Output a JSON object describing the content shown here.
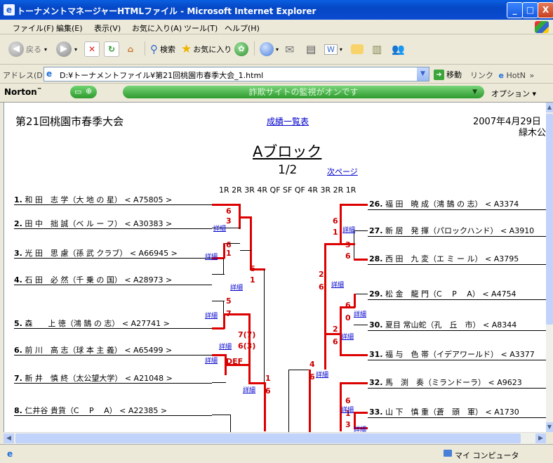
{
  "window": {
    "title": "トーナメントマネージャーHTMLファイル - Microsoft Internet Explorer",
    "controls": [
      "_",
      "□",
      "X"
    ]
  },
  "menu": [
    "ファイル(F)",
    "編集(E)",
    "表示(V)",
    "お気に入り(A)",
    "ツール(T)",
    "ヘルプ(H)"
  ],
  "toolbar": {
    "back": "戻る",
    "search": "検索",
    "favorites": "お気に入り"
  },
  "address": {
    "label": "アドレス(D)",
    "value": "D:¥トーナメントファイル¥第21回桃園市春季大会_1.html",
    "go": "移動",
    "links": "リンク",
    "hotmail": "HotN",
    "more": "»"
  },
  "norton": {
    "brand": "Norton",
    "tm": "™",
    "message": "詐欺サイトの監視がオンです",
    "options": "オプション ▾"
  },
  "page": {
    "event_title": "第21回桃園市春季大会",
    "results_link": "成績一覧表",
    "date": "2007年4月29日",
    "venue": "緑木公",
    "block_title": "Aブロック",
    "page_indicator": "1/2",
    "next_link": "次ページ",
    "rounds_label": "1R 2R 3R 4R QF SF QF 4R 3R 2R 1R",
    "detail_label": "詳細",
    "left_players": [
      {
        "num": "1.",
        "name": "和 田　志 学（大 地 の 星）",
        "id": "< A75805 >"
      },
      {
        "num": "2.",
        "name": "田 中　拙 誠（ベ ル ー フ）",
        "id": "< A30383 >"
      },
      {
        "num": "3.",
        "name": "光 田　思 慮（孫 武 クラブ）",
        "id": "< A66945 >"
      },
      {
        "num": "4.",
        "name": "石 田　必 然（千 乗 の 国）",
        "id": "< A28973 >"
      },
      {
        "num": "5.",
        "name": "森　　上 徳（鴻 鵠 の 志）",
        "id": "< A27741 >"
      },
      {
        "num": "6.",
        "name": "前 川　高 志（球 本 主 義）",
        "id": "< A65499 >"
      },
      {
        "num": "7.",
        "name": "新 井　慎 終（太公望大学）",
        "id": "< A21048 >"
      },
      {
        "num": "8.",
        "name": "仁井谷 貴貨（C　 P　 A）",
        "id": "< A22385 >"
      }
    ],
    "right_players": [
      {
        "num": "26.",
        "name": "福 田　暁 成（鴻 鵠 の 志）",
        "id": "< A3374"
      },
      {
        "num": "27.",
        "name": "新 居　発 揮（パロックハンド）",
        "id": "< A3910"
      },
      {
        "num": "28.",
        "name": "西 田　九 変（エ ミ ー ル）",
        "id": "< A3795"
      },
      {
        "num": "29.",
        "name": "松 金　龍 門（C　 P　 A）",
        "id": "< A4754"
      },
      {
        "num": "30.",
        "name": "夏目 常山蛇（孔　丘　市）",
        "id": "< A8344"
      },
      {
        "num": "31.",
        "name": "福 与　色 帯（イデアワールド）",
        "id": "< A3377"
      },
      {
        "num": "32.",
        "name": "馬　渕　奏（ミランドーラ）",
        "id": "< A9623"
      },
      {
        "num": "33.",
        "name": "山 下　慎 重（蒼　頭　軍）",
        "id": "< A1730"
      }
    ],
    "scores": [
      "6",
      "3",
      "6",
      "1",
      "6",
      "1",
      "5",
      "7",
      "7(7)",
      "6(3)",
      "DEF",
      "1",
      "6",
      "4",
      "6",
      "6",
      "1",
      "3",
      "6",
      "2",
      "6",
      "6",
      "0",
      "2",
      "6",
      "6",
      "1",
      "3"
    ]
  },
  "status": {
    "zone": "マイ コンピュータ"
  }
}
